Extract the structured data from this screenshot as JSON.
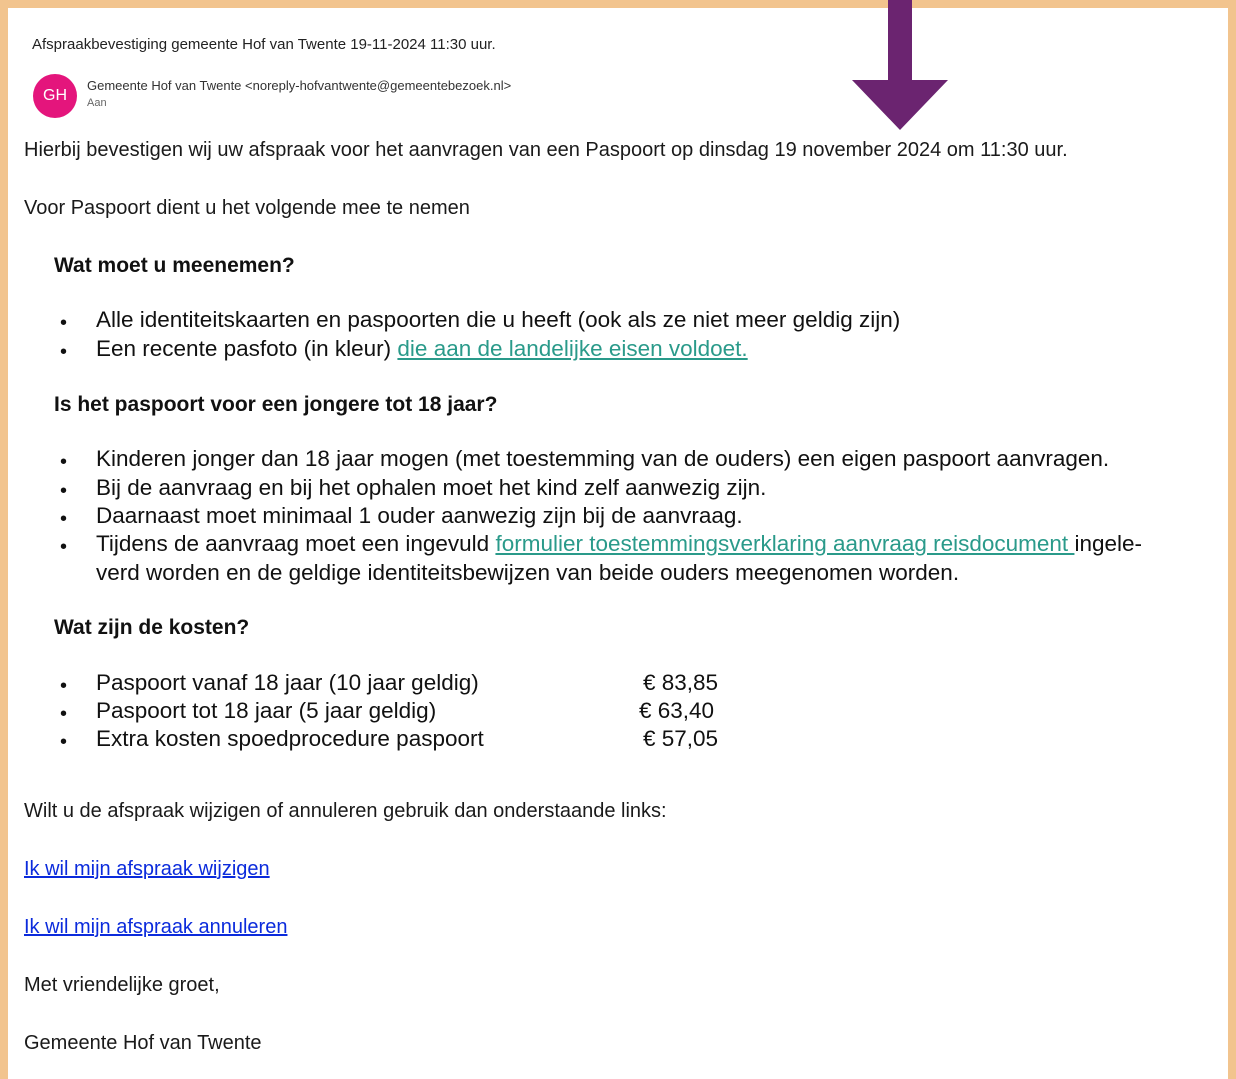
{
  "email": {
    "subject": "Afspraakbevestiging gemeente Hof van Twente 19-11-2024 11:30 uur.",
    "avatar_initials": "GH",
    "sender": "Gemeente Hof van Twente <noreply-hofvantwente@gemeentebezoek.nl>",
    "recipient_label": "Aan"
  },
  "body": {
    "confirmation": "Hierbij bevestigen wij uw afspraak voor het aanvragen van een Paspoort op dinsdag 19 november 2024 om 11:30 uur.",
    "bring_intro": "Voor Paspoort dient u het volgende mee te nemen",
    "section1": {
      "heading": "Wat moet u meenemen?",
      "item1": "Alle identiteitskaarten en paspoorten die u heeft (ook als ze niet meer geldig zijn)",
      "item2_prefix": "Een recente pasfoto (in kleur) ",
      "item2_link": "die aan de landelijke eisen voldoet."
    },
    "section2": {
      "heading": "Is het paspoort voor een jongere tot 18 jaar?",
      "item1": "Kinderen jonger dan 18 jaar mogen (met toestemming van de ouders) een eigen paspoort aanvragen.",
      "item2": "Bij de aanvraag en bij het ophalen moet het kind zelf aanwezig zijn.",
      "item3": "Daarnaast moet minimaal 1 ouder aanwezig zijn bij de aanvraag.",
      "item4_prefix": "Tijdens de aanvraag moet een ingevuld ",
      "item4_link": "formulier toestemmingsverklaring aanvraag reisdocument ",
      "item4_suffix": "ingele-",
      "item4_line2": "verd worden en de geldige identiteitsbewijzen van beide ouders meegenomen worden."
    },
    "section3": {
      "heading": "Wat zijn de kosten?",
      "costs": [
        {
          "label": "Paspoort vanaf 18 jaar (10 jaar geldig)",
          "price": "€ 83,85"
        },
        {
          "label": "Paspoort tot 18 jaar (5 jaar geldig)",
          "price": "€ 63,40"
        },
        {
          "label": "Extra kosten spoedprocedure paspoort",
          "price": "€ 57,05"
        }
      ]
    },
    "change_intro": "Wilt u de afspraak wijzigen of annuleren gebruik dan onderstaande links:",
    "link_change": "Ik wil mijn afspraak wijzigen",
    "link_cancel": "Ik wil mijn afspraak annuleren",
    "closing": "Met vriendelijke groet,",
    "signature": "Gemeente Hof van Twente"
  },
  "colors": {
    "frame": "#f2c48e",
    "arrow": "#6b2470",
    "avatar": "#e4157c",
    "green_link": "#2a9a8a",
    "blue_link": "#0b2bdc"
  },
  "bullet_char": "•"
}
